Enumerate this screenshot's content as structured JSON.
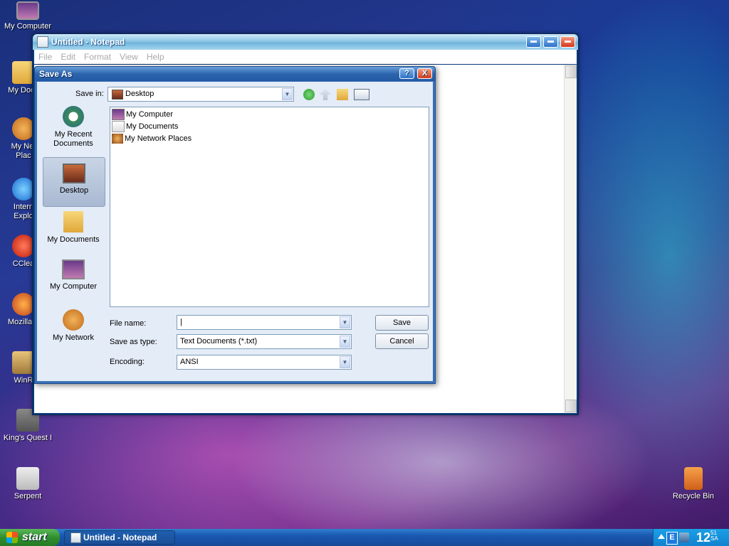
{
  "desktop": {
    "icons": [
      {
        "label": "My Computer"
      },
      {
        "label": "My Docu"
      },
      {
        "label": "My Net\nPlac"
      },
      {
        "label": "Intern\nExplo"
      },
      {
        "label": "CClea"
      },
      {
        "label": "Mozilla F"
      },
      {
        "label": "WinR"
      },
      {
        "label": "King's Quest I"
      },
      {
        "label": "Serpent"
      },
      {
        "label": "Recycle Bin"
      }
    ]
  },
  "notepad": {
    "title": "Untitled - Notepad",
    "menu": [
      "File",
      "Edit",
      "Format",
      "View",
      "Help"
    ]
  },
  "saveas": {
    "title": "Save As",
    "help_btn": "?",
    "close_btn": "X",
    "save_in_label": "Save in:",
    "save_in_value": "Desktop",
    "places": [
      {
        "label": "My Recent\nDocuments"
      },
      {
        "label": "Desktop"
      },
      {
        "label": "My Documents"
      },
      {
        "label": "My Computer"
      },
      {
        "label": "My Network"
      }
    ],
    "files": [
      {
        "name": "My Computer"
      },
      {
        "name": "My Documents"
      },
      {
        "name": "My Network Places"
      }
    ],
    "file_name_label": "File name:",
    "file_name_value": "|",
    "save_as_type_label": "Save as type:",
    "save_as_type_value": "Text Documents (*.txt)",
    "encoding_label": "Encoding:",
    "encoding_value": "ANSI",
    "save_button": "Save",
    "cancel_button": "Cancel"
  },
  "taskbar": {
    "start_label": "start",
    "task_label": "Untitled - Notepad",
    "clock": "12",
    "clock_small": "51\nSA"
  },
  "colors": {
    "dialog_bg": "#e4ecf7",
    "title_blue": "#2c64ae",
    "taskbar_blue": "#1a58b0",
    "start_green": "#2f8f2e"
  }
}
